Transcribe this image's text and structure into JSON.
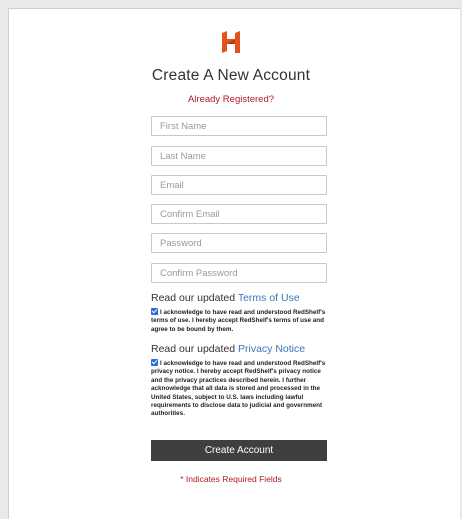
{
  "brand": {
    "logo": "redshelf-h-logo",
    "color": "#e0531f"
  },
  "form": {
    "title": "Create A New Account",
    "already_registered": "Already Registered?",
    "fields": {
      "first_name": {
        "placeholder": "First Name",
        "value": ""
      },
      "last_name": {
        "placeholder": "Last Name",
        "value": ""
      },
      "email": {
        "placeholder": "Email",
        "value": ""
      },
      "confirm_email": {
        "placeholder": "Confirm Email",
        "value": ""
      },
      "password": {
        "placeholder": "Password",
        "value": ""
      },
      "confirm_password": {
        "placeholder": "Confirm Password",
        "value": ""
      }
    },
    "terms": {
      "heading_prefix": "Read our updated",
      "link": "Terms of Use",
      "ack_text": "I acknowledge to have read and understood RedShelf's terms of use. I hereby accept RedShelf's terms of use and agree to be bound by them.",
      "checked": true
    },
    "privacy": {
      "heading_prefix": "Read our updated",
      "link": "Privacy Notice",
      "ack_text": "I acknowledge to have read and understood RedShelf's privacy notice. I hereby accept RedShelf's privacy notice and the privacy practices described herein. I further acknowledge that all data is stored and processed in the United States, subject to U.S. laws including lawful requirements to disclose data to judicial and government authorities.",
      "checked": true
    },
    "submit_label": "Create Account",
    "required_note": "* Indicates Required Fields"
  },
  "colors": {
    "link_red": "#b11c24",
    "link_blue": "#3a78b8",
    "button_bg": "#3f3f3f",
    "checkbox_blue": "#2a6fd6"
  }
}
